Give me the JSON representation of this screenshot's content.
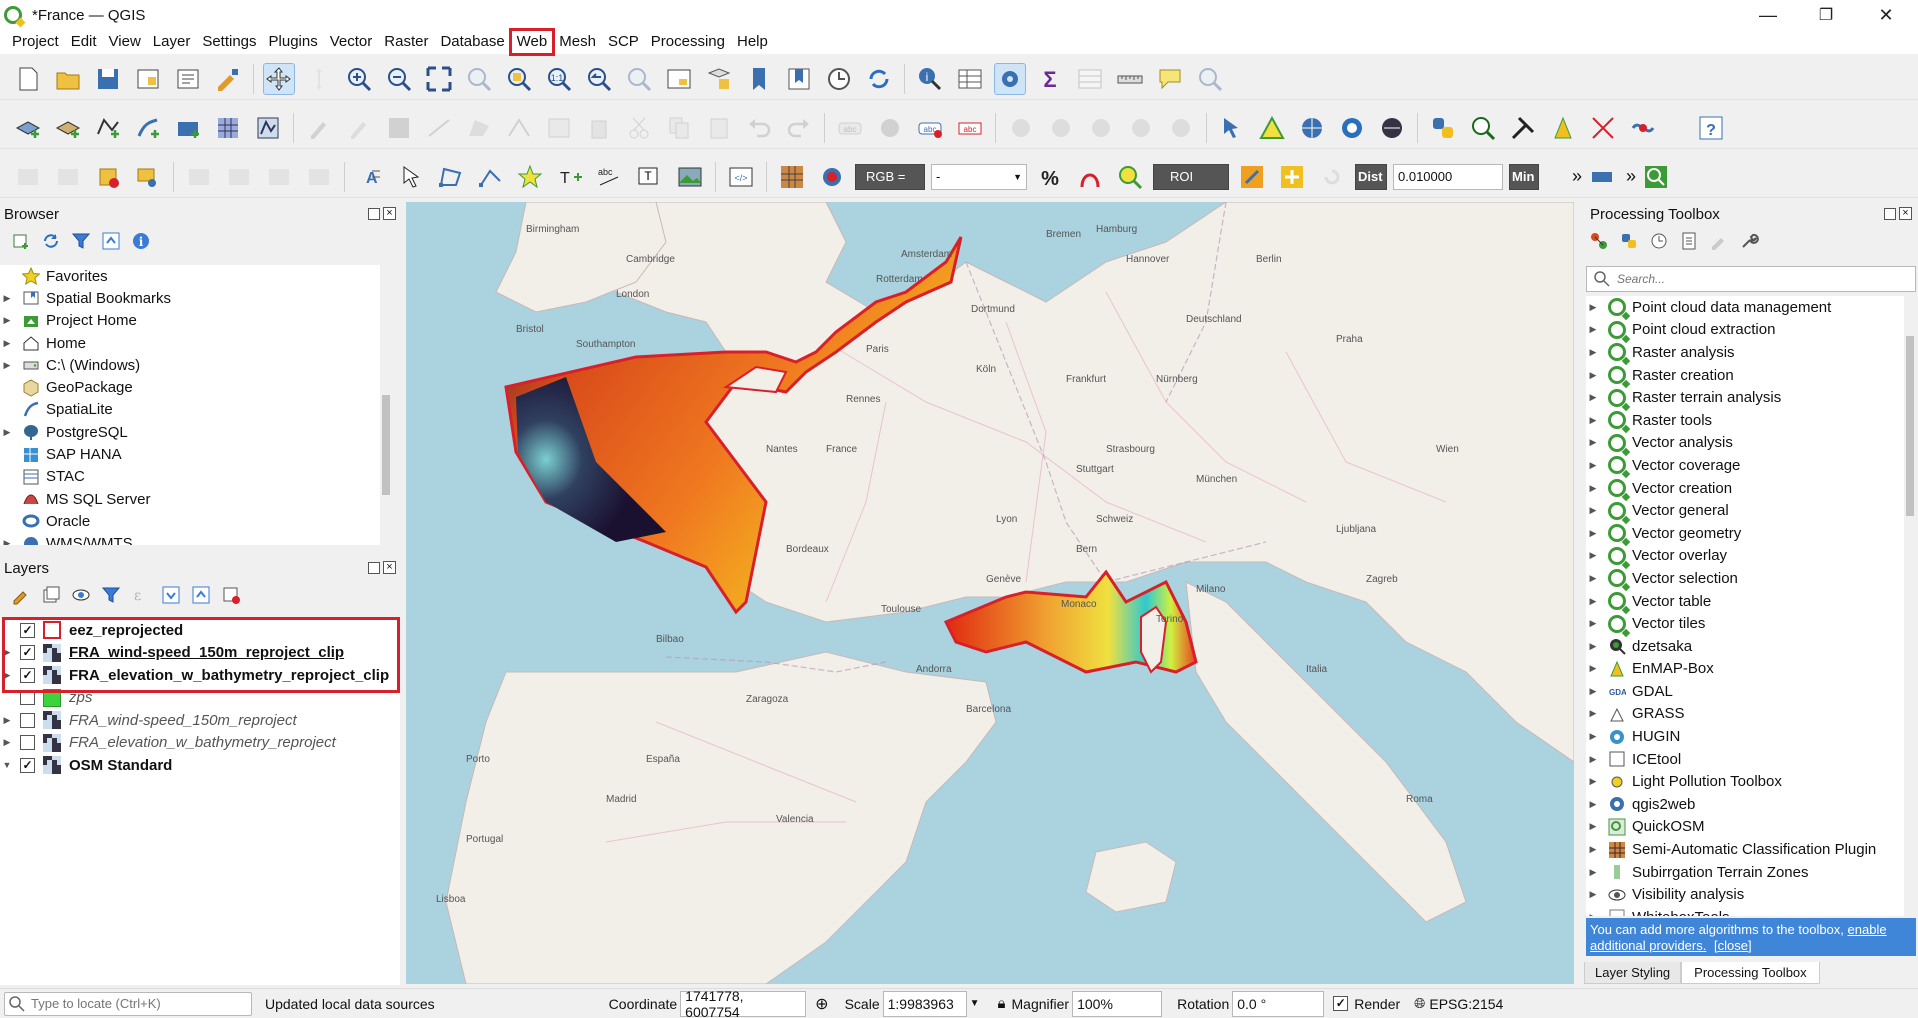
{
  "window": {
    "title": "*France — QGIS",
    "minimize": "—",
    "restore": "❐",
    "close": "✕"
  },
  "menu": [
    "Project",
    "Edit",
    "View",
    "Layer",
    "Settings",
    "Plugins",
    "Vector",
    "Raster",
    "Database",
    "Web",
    "Mesh",
    "SCP",
    "Processing",
    "Help"
  ],
  "highlighted_menu": "Web",
  "toolbar3": {
    "rgb_label": "RGB =",
    "rgb_value": "-",
    "roi_label": "ROI",
    "dist_label": "Dist",
    "dist_value": "0.010000",
    "min_label": "Min"
  },
  "browser": {
    "title": "Browser",
    "items": [
      {
        "label": "Favorites",
        "icon": "star-icon",
        "expandable": false
      },
      {
        "label": "Spatial Bookmarks",
        "icon": "bookmark-icon",
        "expandable": true
      },
      {
        "label": "Project Home",
        "icon": "project-home-icon",
        "expandable": true
      },
      {
        "label": "Home",
        "icon": "home-icon",
        "expandable": true
      },
      {
        "label": "C:\\ (Windows)",
        "icon": "drive-icon",
        "expandable": true
      },
      {
        "label": "GeoPackage",
        "icon": "geopackage-icon",
        "expandable": false
      },
      {
        "label": "SpatiaLite",
        "icon": "spatialite-icon",
        "expandable": false
      },
      {
        "label": "PostgreSQL",
        "icon": "postgresql-icon",
        "expandable": true
      },
      {
        "label": "SAP HANA",
        "icon": "saphana-icon",
        "expandable": false
      },
      {
        "label": "STAC",
        "icon": "stac-icon",
        "expandable": false
      },
      {
        "label": "MS SQL Server",
        "icon": "mssql-icon",
        "expandable": false
      },
      {
        "label": "Oracle",
        "icon": "oracle-icon",
        "expandable": false
      },
      {
        "label": "WMS/WMTS",
        "icon": "wms-icon",
        "expandable": true
      }
    ]
  },
  "layers": {
    "title": "Layers",
    "items": [
      {
        "label": "eez_reprojected",
        "checked": true,
        "bold": true,
        "italic": false,
        "swatch": "outline",
        "expandable": false,
        "underline": false
      },
      {
        "label": "FRA_wind-speed_150m_reproject_clip",
        "checked": true,
        "bold": true,
        "italic": false,
        "swatch": "raster",
        "expandable": true,
        "underline": true
      },
      {
        "label": "FRA_elevation_w_bathymetry_reproject_clip",
        "checked": true,
        "bold": true,
        "italic": false,
        "swatch": "raster",
        "expandable": true,
        "underline": false
      },
      {
        "label": "zps",
        "checked": false,
        "bold": false,
        "italic": true,
        "swatch": "green",
        "expandable": false,
        "underline": false
      },
      {
        "label": "FRA_wind-speed_150m_reproject",
        "checked": false,
        "bold": false,
        "italic": true,
        "swatch": "raster",
        "expandable": true,
        "underline": false
      },
      {
        "label": "FRA_elevation_w_bathymetry_reproject",
        "checked": false,
        "bold": false,
        "italic": true,
        "swatch": "raster",
        "expandable": true,
        "underline": false
      },
      {
        "label": "OSM Standard",
        "checked": true,
        "bold": true,
        "italic": false,
        "swatch": "raster",
        "expandable": true,
        "expanded": true,
        "underline": false
      }
    ]
  },
  "map": {
    "labels": [
      "Birmingham",
      "Cambridge",
      "London",
      "Bristol",
      "Southampton",
      "Amsterdam",
      "Rotterdam",
      "Hamburg",
      "Berlin",
      "Bremen",
      "Hannover",
      "Dortmund",
      "Köln",
      "Frankfurt",
      "Nürnberg",
      "Stuttgart",
      "München",
      "Rennes",
      "Paris",
      "Nantes",
      "France",
      "Strasbourg",
      "Lyon",
      "Bordeaux",
      "Toulouse",
      "Genève",
      "Milano",
      "Torino",
      "Monaco",
      "Andorra",
      "Barcelona",
      "Zaragoza",
      "Madrid",
      "Valencia",
      "Porto",
      "Lisboa",
      "Bilbao",
      "Praha",
      "Wien",
      "Ljubljana",
      "Zagreb",
      "Bern",
      "Schweiz",
      "Deutschland",
      "Italia",
      "Portugal",
      "España",
      "Roma"
    ]
  },
  "toolbox": {
    "title": "Processing Toolbox",
    "search_placeholder": "Search...",
    "items": [
      {
        "label": "Point cloud data management",
        "icon": "qgis-icon"
      },
      {
        "label": "Point cloud extraction",
        "icon": "qgis-icon"
      },
      {
        "label": "Raster analysis",
        "icon": "qgis-icon"
      },
      {
        "label": "Raster creation",
        "icon": "qgis-icon"
      },
      {
        "label": "Raster terrain analysis",
        "icon": "qgis-icon"
      },
      {
        "label": "Raster tools",
        "icon": "qgis-icon"
      },
      {
        "label": "Vector analysis",
        "icon": "qgis-icon"
      },
      {
        "label": "Vector coverage",
        "icon": "qgis-icon"
      },
      {
        "label": "Vector creation",
        "icon": "qgis-icon"
      },
      {
        "label": "Vector general",
        "icon": "qgis-icon"
      },
      {
        "label": "Vector geometry",
        "icon": "qgis-icon"
      },
      {
        "label": "Vector overlay",
        "icon": "qgis-icon"
      },
      {
        "label": "Vector selection",
        "icon": "qgis-icon"
      },
      {
        "label": "Vector table",
        "icon": "qgis-icon"
      },
      {
        "label": "Vector tiles",
        "icon": "qgis-icon"
      },
      {
        "label": "dzetsaka",
        "icon": "dzetsaka-icon"
      },
      {
        "label": "EnMAP-Box",
        "icon": "enmap-icon"
      },
      {
        "label": "GDAL",
        "icon": "gdal-icon"
      },
      {
        "label": "GRASS",
        "icon": "grass-icon"
      },
      {
        "label": "HUGIN",
        "icon": "hugin-icon"
      },
      {
        "label": "ICEtool",
        "icon": "icetool-icon"
      },
      {
        "label": "Light Pollution Toolbox",
        "icon": "lightpollution-icon"
      },
      {
        "label": "qgis2web",
        "icon": "qgis2web-icon"
      },
      {
        "label": "QuickOSM",
        "icon": "quickosm-icon"
      },
      {
        "label": "Semi-Automatic Classification Plugin",
        "icon": "scp-icon"
      },
      {
        "label": "Subirrgation Terrain Zones",
        "icon": "subirrigation-icon"
      },
      {
        "label": "Visibility analysis",
        "icon": "eye-icon"
      },
      {
        "label": "WhiteboxTools",
        "icon": "whitebox-icon"
      }
    ],
    "info_text": "You can add more algorithms to the toolbox,",
    "info_link": "enable additional providers.",
    "info_close": "[close]"
  },
  "tabs": {
    "layer_styling": "Layer Styling",
    "processing_toolbox": "Processing Toolbox"
  },
  "status": {
    "locate_placeholder": "Type to locate (Ctrl+K)",
    "message": "Updated local data sources",
    "coordinate_label": "Coordinate",
    "coordinate_value": "1741778, 6007754",
    "scale_label": "Scale",
    "scale_value": "1:9983963",
    "magnifier_label": "Magnifier",
    "magnifier_value": "100%",
    "rotation_label": "Rotation",
    "rotation_value": "0.0 °",
    "render_label": "Render",
    "crs": "EPSG:2154"
  },
  "colors": {
    "highlight": "#d8202a",
    "qgis_green": "#3c9b37",
    "link": "#0000ee",
    "info_bg": "#3f86d8"
  }
}
